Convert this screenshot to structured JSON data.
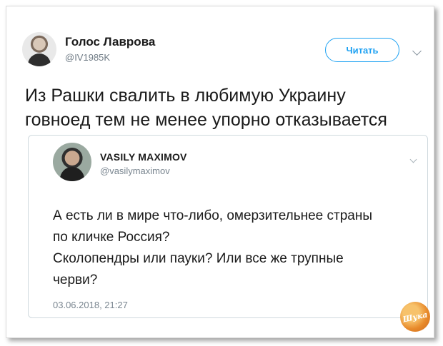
{
  "tweet": {
    "author_name": "Голос Лаврова",
    "author_handle": "@IV1985K",
    "follow_label": "Читать",
    "text_lines": [
      "Из Рашки свалить в любимую Украину",
      "говноед тем не менее упорно отказывается"
    ]
  },
  "quoted_tweet": {
    "author_name": "VASILY MAXIMOV",
    "author_handle": "@vasilymaximov",
    "text_lines": [
      "А есть ли в мире что-либо, омерзительнее страны",
      "по кличке Россия?",
      "Сколопендры или пауки? Или все же трупные",
      "черви?"
    ],
    "date": "03.06.2018, 21:27"
  },
  "watermark": {
    "text": "Шука"
  },
  "colors": {
    "accent": "#1da1f2",
    "secondary_text": "#6f7b85",
    "border": "#cfd9de"
  },
  "icons": {
    "more_menu": "chevron-down-icon"
  }
}
